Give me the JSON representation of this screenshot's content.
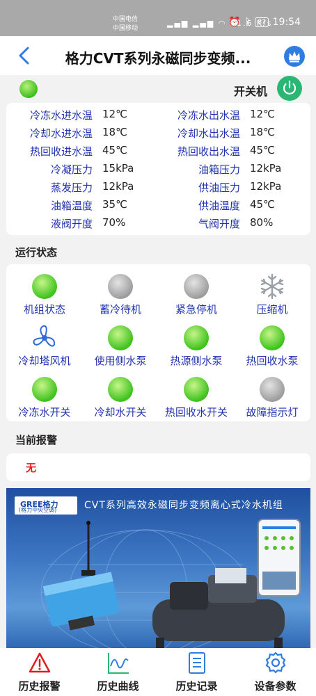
{
  "status_bar": {
    "carrier1": "中国电信",
    "carrier2": "中国移动",
    "speed": "11.6 K/s",
    "battery": "87",
    "time": "19:54"
  },
  "header": {
    "title": "格力CVT系列永磁同步变频..."
  },
  "switch": {
    "label": "开关机",
    "indicator_color": "#3cbf1e"
  },
  "params": [
    {
      "l": "冷冻水进水温",
      "v": "12℃",
      "l2": "冷冻水出水温",
      "v2": "12℃"
    },
    {
      "l": "冷却水进水温",
      "v": "18℃",
      "l2": "冷却水出水温",
      "v2": "18℃"
    },
    {
      "l": "热回收进水温",
      "v": "45℃",
      "l2": "热回收出水温",
      "v2": "45℃"
    },
    {
      "l": "冷凝压力",
      "v": "15kPa",
      "l2": "油箱压力",
      "v2": "12kPa"
    },
    {
      "l": "蒸发压力",
      "v": "12kPa",
      "l2": "供油压力",
      "v2": "12kPa"
    },
    {
      "l": "油箱温度",
      "v": "35℃",
      "l2": "供油温度",
      "v2": "45℃"
    },
    {
      "l": "液阀开度",
      "v": "70%",
      "l2": "气阀开度",
      "v2": "80%"
    }
  ],
  "running": {
    "title": "运行状态",
    "items": [
      {
        "label": "机组状态",
        "state": "green"
      },
      {
        "label": "蓄冷待机",
        "state": "gray"
      },
      {
        "label": "紧急停机",
        "state": "gray"
      },
      {
        "label": "压缩机",
        "state": "snowflake-icon"
      },
      {
        "label": "冷却塔风机",
        "state": "fan-icon"
      },
      {
        "label": "使用侧水泵",
        "state": "green"
      },
      {
        "label": "热源侧水泵",
        "state": "green"
      },
      {
        "label": "热回收水泵",
        "state": "green"
      },
      {
        "label": "冷冻水开关",
        "state": "green"
      },
      {
        "label": "冷却水开关",
        "state": "green"
      },
      {
        "label": "热回收水开关",
        "state": "green"
      },
      {
        "label": "故障指示灯",
        "state": "gray"
      }
    ]
  },
  "alarm": {
    "title": "当前报警",
    "value": "无"
  },
  "banner": {
    "brand": "GREE格力",
    "brand_sub": "(格力中央空调)",
    "title": "CVT系列高效永磁同步变频离心式冷水机组"
  },
  "nav": [
    {
      "label": "历史报警",
      "icon": "warning-icon"
    },
    {
      "label": "历史曲线",
      "icon": "chart-icon"
    },
    {
      "label": "历史记录",
      "icon": "document-icon"
    },
    {
      "label": "设备参数",
      "icon": "gear-icon"
    }
  ],
  "colors": {
    "label_blue": "#2233b0",
    "alarm_red": "#e21b1b",
    "power_green": "#2bb673",
    "crown_blue": "#2f7de1"
  }
}
